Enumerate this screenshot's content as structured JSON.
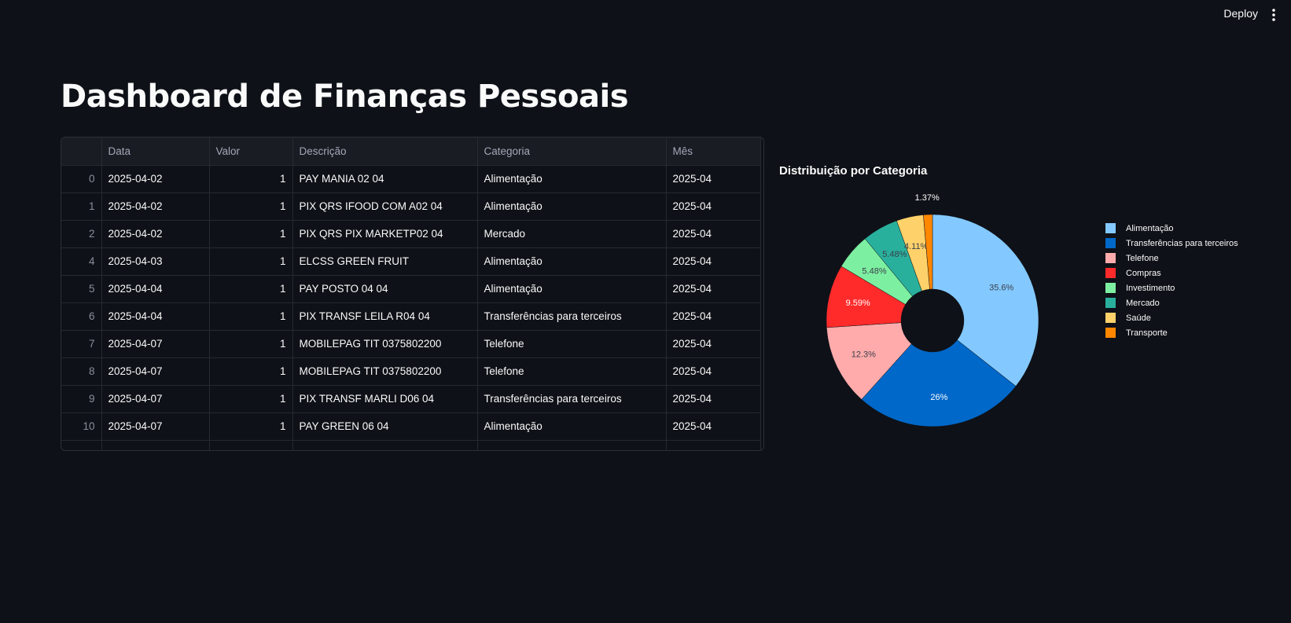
{
  "header": {
    "deploy_label": "Deploy",
    "menu_icon": "more-vertical-icon"
  },
  "page": {
    "title": "Dashboard de Finanças Pessoais"
  },
  "table": {
    "columns": [
      "",
      "Data",
      "Valor",
      "Descrição",
      "Categoria",
      "Mês"
    ],
    "rows": [
      [
        "0",
        "2025-04-02",
        "1",
        "PAY   MANIA 02 04",
        "Alimentação",
        "2025-04"
      ],
      [
        "1",
        "2025-04-02",
        "1",
        "PIX QRS IFOOD COM A02 04",
        "Alimentação",
        "2025-04"
      ],
      [
        "2",
        "2025-04-02",
        "1",
        "PIX QRS PIX MARKETP02 04",
        "Mercado",
        "2025-04"
      ],
      [
        "4",
        "2025-04-03",
        "1",
        "ELCSS GREEN FRUIT",
        "Alimentação",
        "2025-04"
      ],
      [
        "5",
        "2025-04-04",
        "1",
        "PAY   POSTO 04 04",
        "Alimentação",
        "2025-04"
      ],
      [
        "6",
        "2025-04-04",
        "1",
        "PIX TRANSF  LEILA R04 04",
        "Transferências para terceiros",
        "2025-04"
      ],
      [
        "7",
        "2025-04-07",
        "1",
        "MOBILEPAG TIT 0375802200",
        "Telefone",
        "2025-04"
      ],
      [
        "8",
        "2025-04-07",
        "1",
        "MOBILEPAG TIT 0375802200",
        "Telefone",
        "2025-04"
      ],
      [
        "9",
        "2025-04-07",
        "1",
        "PIX TRANSF  MARLI D06 04",
        "Transferências para terceiros",
        "2025-04"
      ],
      [
        "10",
        "2025-04-07",
        "1",
        "PAY   GREEN 06 04",
        "Alimentação",
        "2025-04"
      ],
      [
        "",
        "",
        "",
        "",
        "",
        ""
      ]
    ]
  },
  "chart_data": {
    "type": "pie",
    "title": "Distribuição por Categoria",
    "hole": true,
    "legend_position": "right",
    "categories": [
      "Alimentação",
      "Transferências para terceiros",
      "Telefone",
      "Compras",
      "Investimento",
      "Mercado",
      "Saúde",
      "Transporte"
    ],
    "values": [
      35.6,
      26,
      12.3,
      9.59,
      5.48,
      5.48,
      4.11,
      1.37
    ],
    "labels": [
      "35.6%",
      "26%",
      "12.3%",
      "9.59%",
      "5.48%",
      "5.48%",
      "4.11%",
      "1.37%"
    ],
    "colors": [
      "#83c9ff",
      "#0068c9",
      "#ffabab",
      "#ff2b2b",
      "#7defa1",
      "#29b09d",
      "#ffd16a",
      "#ff8700"
    ]
  }
}
